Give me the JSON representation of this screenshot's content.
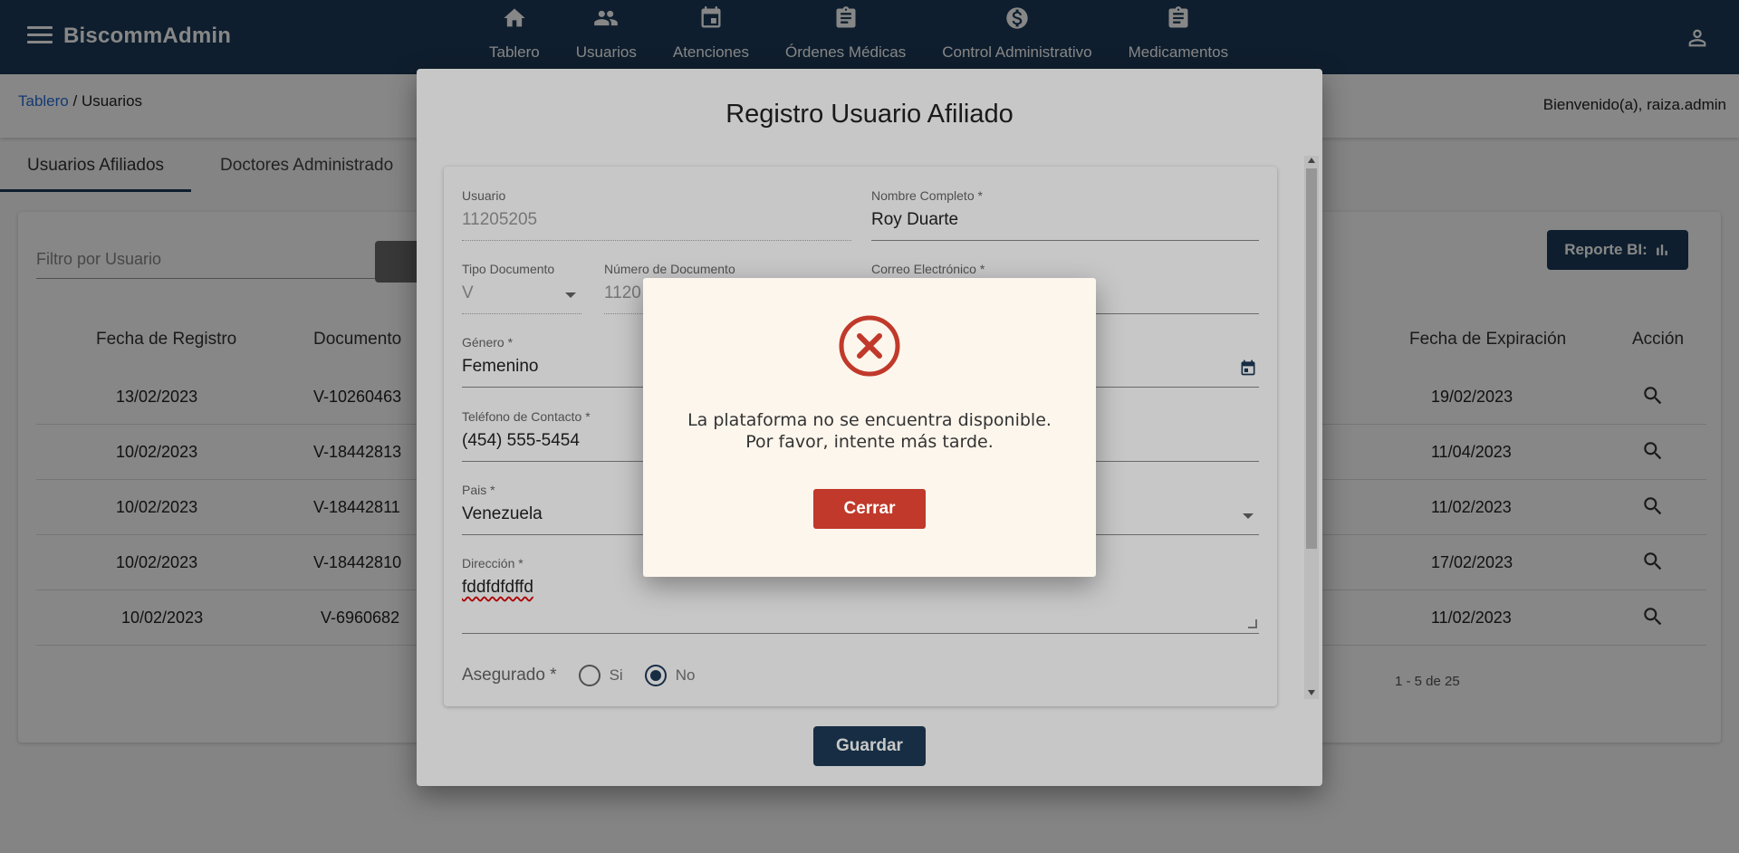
{
  "app": {
    "brand": "BiscommAdmin"
  },
  "nav": [
    {
      "label": "Tablero",
      "icon": "home-icon"
    },
    {
      "label": "Usuarios",
      "icon": "people-icon"
    },
    {
      "label": "Atenciones",
      "icon": "calendar-icon"
    },
    {
      "label": "Órdenes Médicas",
      "icon": "clipboard-icon"
    },
    {
      "label": "Control Administrativo",
      "icon": "dollar-icon"
    },
    {
      "label": "Medicamentos",
      "icon": "clipboard-icon"
    }
  ],
  "breadcrumb": {
    "link": "Tablero",
    "current": "/ Usuarios"
  },
  "welcome": "Bienvenido(a), raiza.admin",
  "tabs": [
    "Usuarios Afiliados",
    "Doctores Administrado"
  ],
  "filter": {
    "placeholder": "Filtro por Usuario"
  },
  "report_button": "Reporte BI:",
  "table": {
    "headers": [
      "Fecha de Registro",
      "Documento",
      "Fecha de Expiración",
      "Acción"
    ],
    "rows": [
      {
        "fecha": "13/02/2023",
        "documento": "V-10260463",
        "expiracion": "19/02/2023"
      },
      {
        "fecha": "10/02/2023",
        "documento": "V-18442813",
        "expiracion": "11/04/2023"
      },
      {
        "fecha": "10/02/2023",
        "documento": "V-18442811",
        "expiracion": "11/02/2023"
      },
      {
        "fecha": "10/02/2023",
        "documento": "V-18442810",
        "expiracion": "17/02/2023"
      },
      {
        "fecha": "10/02/2023",
        "documento": "V-6960682",
        "expiracion": "11/02/2023"
      }
    ],
    "paginator": "1 - 5 de 25"
  },
  "dialog": {
    "title": "Registro Usuario Afiliado",
    "fields": {
      "usuario": {
        "label": "Usuario",
        "value": "11205205"
      },
      "nombre": {
        "label": "Nombre Completo *",
        "value": "Roy Duarte"
      },
      "tipo_doc": {
        "label": "Tipo Documento",
        "value": "V"
      },
      "num_doc": {
        "label": "Número de Documento",
        "value": "1120"
      },
      "correo": {
        "label": "Correo Electrónico *",
        "value": ""
      },
      "genero": {
        "label": "Género *",
        "value": "Femenino"
      },
      "telefono": {
        "label": "Teléfono de Contacto *",
        "value": "(454) 555-5454"
      },
      "pais": {
        "label": "Pais *",
        "value": "Venezuela"
      },
      "direccion": {
        "label": "Dirección *",
        "value": "fddfdfdffd"
      }
    },
    "asegurado": {
      "label": "Asegurado *",
      "options": [
        "Si",
        "No"
      ],
      "selected": "No"
    },
    "save_label": "Guardar"
  },
  "alert": {
    "line1": "La plataforma no se encuentra disponible.",
    "line2": "Por favor, intente más tarde.",
    "close_label": "Cerrar"
  },
  "colors": {
    "primary": "#1d3a57",
    "danger": "#c0392b",
    "alert_bg": "#fdf6ec"
  }
}
